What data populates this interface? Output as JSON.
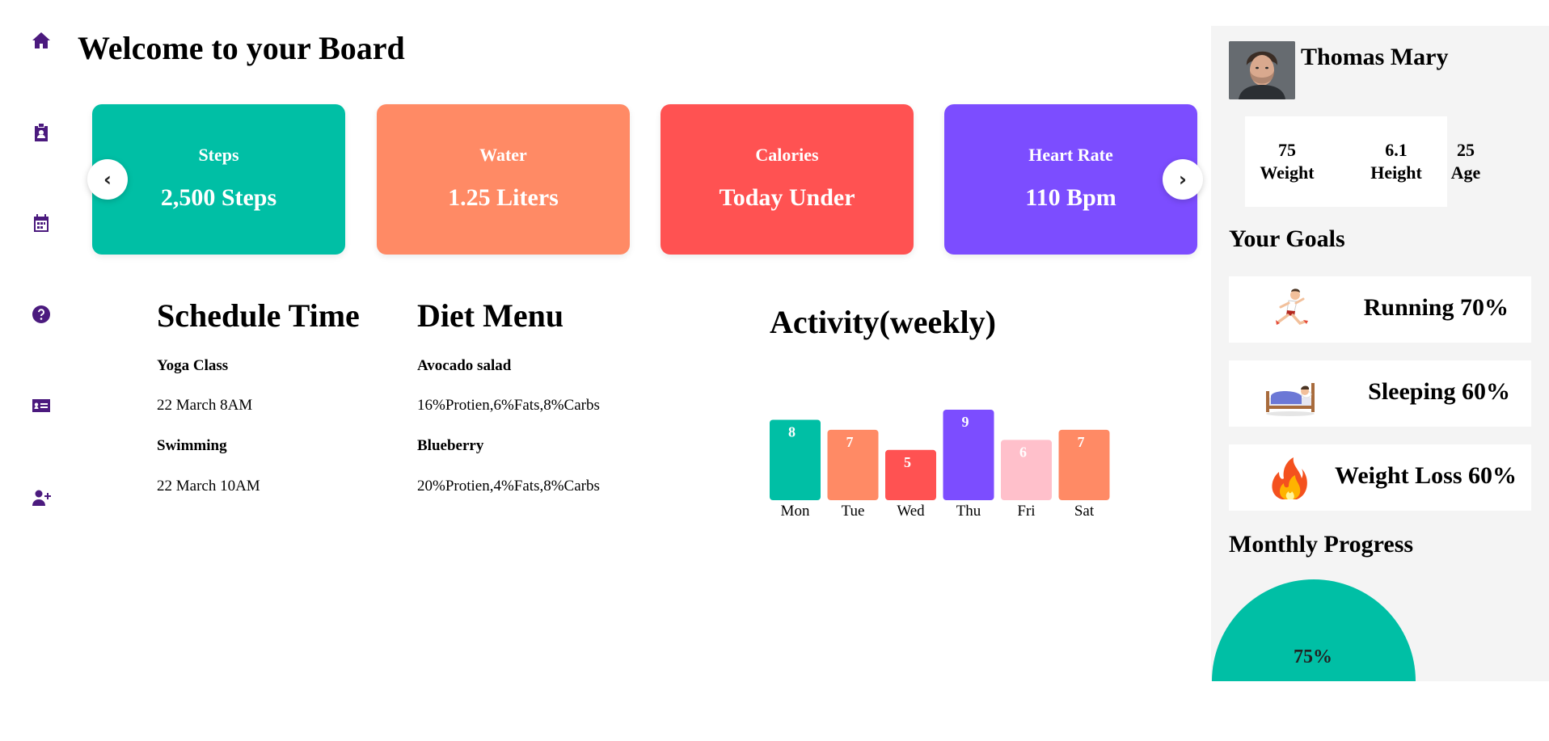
{
  "page_title": "Welcome to your Board",
  "sidebar": {
    "icons": [
      "home-icon",
      "id-badge-icon",
      "calendar-icon",
      "help-circle-icon",
      "contact-card-icon",
      "add-user-icon"
    ],
    "color": "#4b1a7e"
  },
  "stats": [
    {
      "label": "Steps",
      "value": "2,500 Steps",
      "color": "#00bfa5"
    },
    {
      "label": "Water",
      "value": "1.25 Liters",
      "color": "#ff8a65"
    },
    {
      "label": "Calories",
      "value": "Today Under",
      "color": "#ff5252"
    },
    {
      "label": "Heart Rate",
      "value": "110 Bpm",
      "color": "#7c4dff"
    }
  ],
  "carousel": {
    "prev": "‹",
    "next": "›"
  },
  "schedule": {
    "title": "Schedule Time",
    "items": [
      {
        "name": "Yoga Class",
        "time": "22 March 8AM"
      },
      {
        "name": "Swimming",
        "time": "22 March 10AM"
      }
    ]
  },
  "diet": {
    "title": "Diet Menu",
    "items": [
      {
        "name": "Avocado salad",
        "detail": "16%Protien,6%Fats,8%Carbs"
      },
      {
        "name": "Blueberry",
        "detail": "20%Protien,4%Fats,8%Carbs"
      }
    ]
  },
  "activity": {
    "title": "Activity(weekly)"
  },
  "chart_data": {
    "type": "bar",
    "title": "Activity(weekly)",
    "categories": [
      "Mon",
      "Tue",
      "Wed",
      "Thu",
      "Fri",
      "Sat"
    ],
    "values": [
      8,
      7,
      5,
      9,
      6,
      7
    ],
    "colors": [
      "#00bfa5",
      "#ff8a65",
      "#ff5252",
      "#7c4dff",
      "#ffc0cb",
      "#ff8a65"
    ],
    "ylim": [
      0,
      9
    ],
    "grid": false,
    "data_labels": true
  },
  "profile": {
    "name": "Thomas Mary",
    "metrics": [
      {
        "value": "75",
        "label": "Weight"
      },
      {
        "value": "6.1",
        "label": "Height"
      },
      {
        "value": "25",
        "label": "Age"
      }
    ]
  },
  "goals": {
    "title": "Your Goals",
    "items": [
      {
        "label": "Running 70%",
        "icon": "running-icon"
      },
      {
        "label": "Sleeping 60%",
        "icon": "sleeping-icon"
      },
      {
        "label": "Weight Loss 60%",
        "icon": "fire-icon"
      }
    ]
  },
  "monthly_progress": {
    "title": "Monthly Progress",
    "label": "75%",
    "value": 0.75,
    "color": "#00bfa5"
  }
}
